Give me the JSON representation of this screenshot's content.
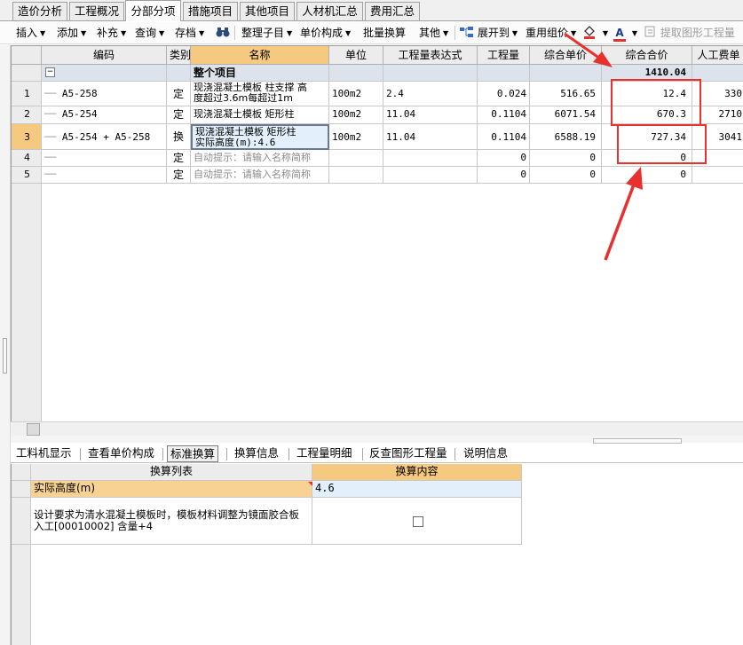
{
  "tabs": [
    {
      "label": "造价分析"
    },
    {
      "label": "工程概况"
    },
    {
      "label": "分部分项"
    },
    {
      "label": "措施项目"
    },
    {
      "label": "其他项目"
    },
    {
      "label": "人材机汇总"
    },
    {
      "label": "费用汇总"
    }
  ],
  "toolbar": {
    "insert": "插入",
    "add": "添加",
    "supplement": "补充",
    "query": "查询",
    "archive": "存档",
    "organize": "整理子目",
    "unit_composition": "单价构成",
    "batch_convert": "批量换算",
    "other": "其他",
    "expand": "展开到",
    "reuse_price": "重用组价",
    "font_color_letter": "A",
    "extract_quantity": "提取图形工程量"
  },
  "grid": {
    "columns": {
      "code": "编码",
      "type": "类别",
      "name": "名称",
      "unit": "单位",
      "expr": "工程量表达式",
      "qty": "工程量",
      "unit_price": "综合单价",
      "total": "综合合价",
      "labor": "人工费单"
    },
    "summary": {
      "name": "整个项目",
      "total": "1410.04"
    },
    "rows": [
      {
        "no": "1",
        "code": "A5-258",
        "type": "定",
        "name_l1": "现浇混凝土模板 柱支撑 高",
        "name_l2": "度超过3.6m每超过1m",
        "unit": "100m2",
        "expr": "2.4",
        "qty": "0.024",
        "unit_price": "516.65",
        "total": "12.4",
        "labor": "330"
      },
      {
        "no": "2",
        "code": "A5-254",
        "type": "定",
        "name_l1": "现浇混凝土模板 矩形柱",
        "name_l2": "",
        "unit": "100m2",
        "expr": "11.04",
        "qty": "0.1104",
        "unit_price": "6071.54",
        "total": "670.3",
        "labor": "2710"
      },
      {
        "no": "3",
        "code": "A5-254 + A5-258",
        "type": "换",
        "name_l1": "现浇混凝土模板 矩形柱",
        "name_l2": "实际高度(m):4.6",
        "unit": "100m2",
        "expr": "11.04",
        "qty": "0.1104",
        "unit_price": "6588.19",
        "total": "727.34",
        "labor": "3041"
      },
      {
        "no": "4",
        "code": "",
        "type": "定",
        "name_l1": "自动提示：请输入名称简称",
        "name_l2": "",
        "unit": "",
        "expr": "",
        "qty": "0",
        "unit_price": "0",
        "total": "0",
        "labor": ""
      },
      {
        "no": "5",
        "code": "",
        "type": "定",
        "name_l1": "自动提示：请输入名称简称",
        "name_l2": "",
        "unit": "",
        "expr": "",
        "qty": "0",
        "unit_price": "0",
        "total": "0",
        "labor": ""
      }
    ]
  },
  "bottom_tabs": [
    {
      "label": "工料机显示"
    },
    {
      "label": "查看单价构成"
    },
    {
      "label": "标准换算"
    },
    {
      "label": "换算信息"
    },
    {
      "label": "工程量明细"
    },
    {
      "label": "反查图形工程量"
    },
    {
      "label": "说明信息"
    }
  ],
  "panel": {
    "col_list": "换算列表",
    "col_content": "换算内容",
    "row1_label": "实际高度(m)",
    "row1_value": "4.6",
    "row2_line1": "设计要求为清水混凝土模板时，模板材料调整为镜面胶合板",
    "row2_line2": "入工[00010002] 含量+4"
  },
  "colors": {
    "annotation_red": "#e8312f",
    "selected_header": "#f6c981",
    "input_bg": "#e3f0fb"
  }
}
